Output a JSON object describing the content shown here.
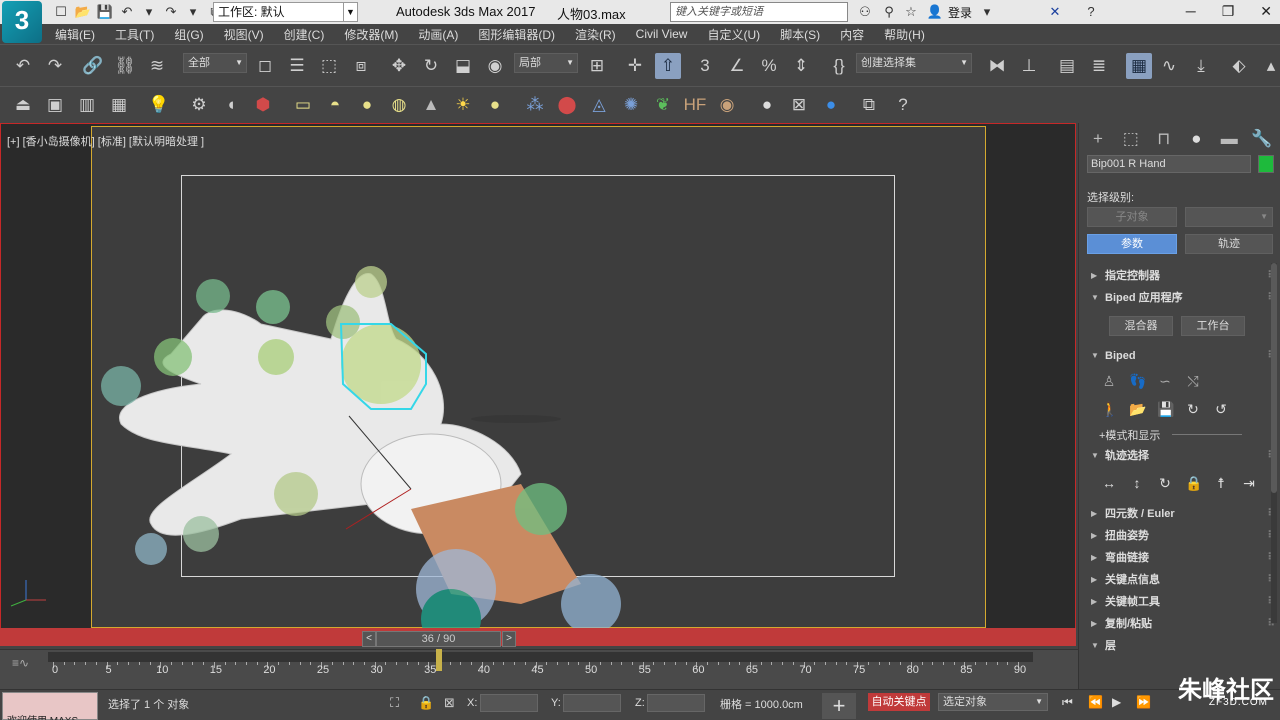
{
  "app": {
    "logo": "3",
    "title": "Autodesk 3ds Max 2017",
    "file": "人物03.max",
    "workspace": "工作区: 默认",
    "search_placeholder": "键入关键字或短语",
    "login": "登录"
  },
  "menu": [
    "编辑(E)",
    "工具(T)",
    "组(G)",
    "视图(V)",
    "创建(C)",
    "修改器(M)",
    "动画(A)",
    "图形编辑器(D)",
    "渲染(R)",
    "Civil View",
    "自定义(U)",
    "脚本(S)",
    "内容",
    "帮助(H)"
  ],
  "toolbar": {
    "selection_filter": "全部",
    "ref_coord": "局部",
    "named_selection": "创建选择集"
  },
  "viewport": {
    "label": "[+] [香小岛摄像机] [标准] [默认明暗处理 ]",
    "frame_display": "36 / 90"
  },
  "command_panel": {
    "object_name": "Bip001 R Hand",
    "object_color": "#1eba3c",
    "selection_level_label": "选择级别:",
    "sub_object_btn": "子对象",
    "params_btn": "参数",
    "track_btn": "轨迹",
    "rollouts": {
      "assign_controller": "指定控制器",
      "biped_apps": "Biped 应用程序",
      "mixer_btn": "混合器",
      "workbench_btn": "工作台",
      "biped": "Biped",
      "mode_display": "+模式和显示",
      "track_selection": "轨迹选择",
      "quaternion": "四元数 / Euler",
      "twist_poses": "扭曲姿势",
      "bend_links": "弯曲链接",
      "key_info": "关键点信息",
      "keyframe_tools": "关键帧工具",
      "copy_paste": "复制/粘贴",
      "layers": "层"
    }
  },
  "timeline": {
    "ticks": [
      0,
      5,
      10,
      15,
      20,
      25,
      30,
      35,
      40,
      45,
      50,
      55,
      60,
      65,
      70,
      75,
      80,
      85,
      90
    ],
    "current_frame": 36
  },
  "status": {
    "maxscript": "欢迎使用 MAXS",
    "message": "选择了 1 个 对象",
    "x_label": "X:",
    "y_label": "Y:",
    "z_label": "Z:",
    "grid": "栅格 = 1000.0cm",
    "auto_key": "自动关键点",
    "selected_object": "选定对象"
  },
  "watermark": {
    "text": "朱峰社区",
    "sub": "ZF3D.COM"
  }
}
